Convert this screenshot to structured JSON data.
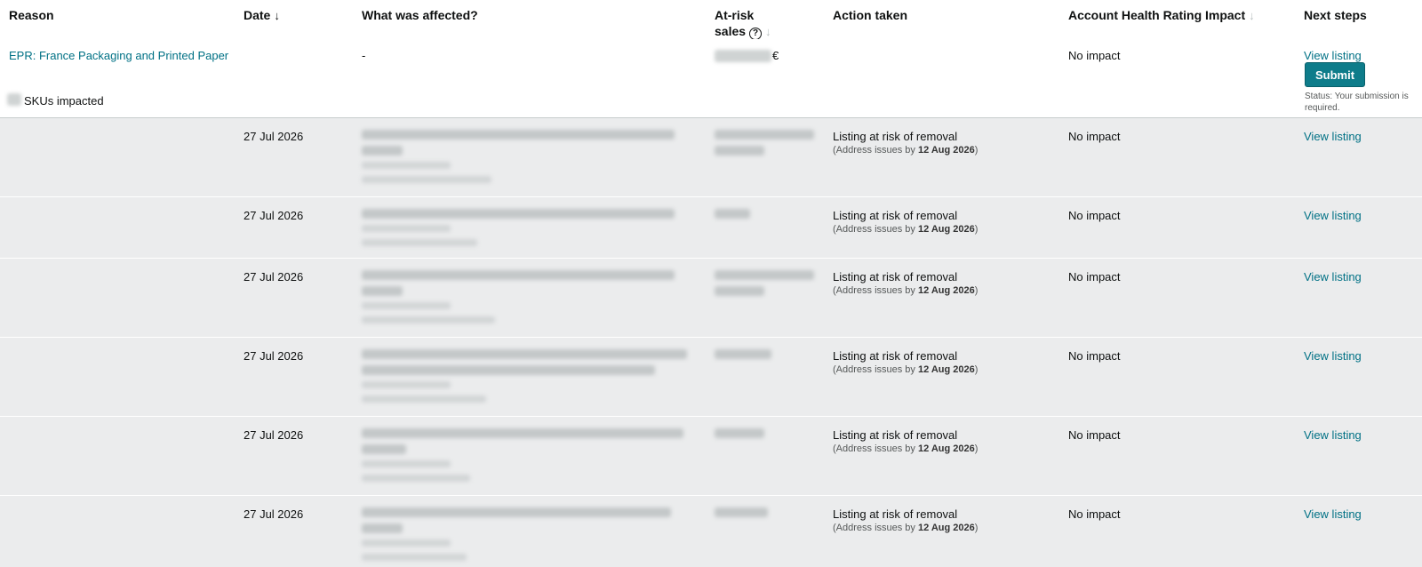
{
  "columns": {
    "reason": "Reason",
    "date": "Date",
    "date_sort": "↓",
    "affected": "What was affected?",
    "at_risk_line1": "At-risk",
    "at_risk_line2": "sales",
    "help_glyph": "?",
    "at_risk_sort": "↓",
    "action": "Action taken",
    "ahr": "Account Health Rating Impact",
    "ahr_sort": "↓",
    "next": "Next steps"
  },
  "summary": {
    "reason_link": "EPR: France Packaging and Printed Paper",
    "skus_label": "SKUs impacted",
    "affected": "-",
    "currency": "€",
    "ahr": "No impact",
    "view_listing": "View listing",
    "submit": "Submit",
    "status": "Status: Your submission is required."
  },
  "rows": [
    {
      "date": "27 Jul 2026",
      "action": "Listing at risk of removal",
      "sub_prefix": "(Address issues by ",
      "sub_date": "12 Aug 2026",
      "sub_suffix": ")",
      "ahr": "No impact",
      "next": "View listing"
    },
    {
      "date": "27 Jul 2026",
      "action": "Listing at risk of removal",
      "sub_prefix": "(Address issues by ",
      "sub_date": "12 Aug 2026",
      "sub_suffix": ")",
      "ahr": "No impact",
      "next": "View listing"
    },
    {
      "date": "27 Jul 2026",
      "action": "Listing at risk of removal",
      "sub_prefix": "(Address issues by ",
      "sub_date": "12 Aug 2026",
      "sub_suffix": ")",
      "ahr": "No impact",
      "next": "View listing"
    },
    {
      "date": "27 Jul 2026",
      "action": "Listing at risk of removal",
      "sub_prefix": "(Address issues by ",
      "sub_date": "12 Aug 2026",
      "sub_suffix": ")",
      "ahr": "No impact",
      "next": "View listing"
    },
    {
      "date": "27 Jul 2026",
      "action": "Listing at risk of removal",
      "sub_prefix": "(Address issues by ",
      "sub_date": "12 Aug 2026",
      "sub_suffix": ")",
      "ahr": "No impact",
      "next": "View listing"
    },
    {
      "date": "27 Jul 2026",
      "action": "Listing at risk of removal",
      "sub_prefix": "(Address issues by ",
      "sub_date": "12 Aug 2026",
      "sub_suffix": ")",
      "ahr": "No impact",
      "next": "View listing"
    }
  ],
  "colors": {
    "link": "#007185",
    "button": "#0e7c8a",
    "row_bg": "#ebeced",
    "header_border": "#d5d9d9"
  }
}
